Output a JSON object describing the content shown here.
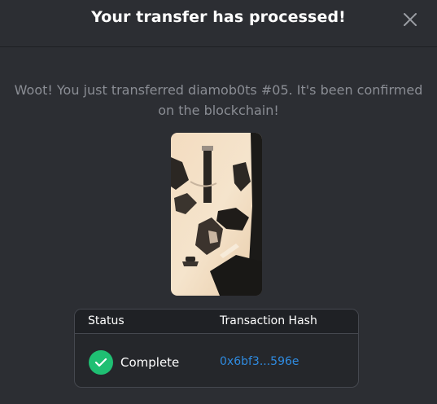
{
  "modal": {
    "title": "Your transfer has processed!",
    "message": "Woot! You just transferred diamob0ts #05. It's been confirmed on the blockchain!"
  },
  "icons": {
    "close": "close-icon",
    "check": "check-icon"
  },
  "table": {
    "headers": [
      "Status",
      "Transaction Hash"
    ],
    "row": {
      "status": "Complete",
      "hash": "0x6bf3...596e"
    }
  },
  "colors": {
    "background": "#2c2e33",
    "success": "#1fbf73",
    "link": "#2f8be0"
  }
}
